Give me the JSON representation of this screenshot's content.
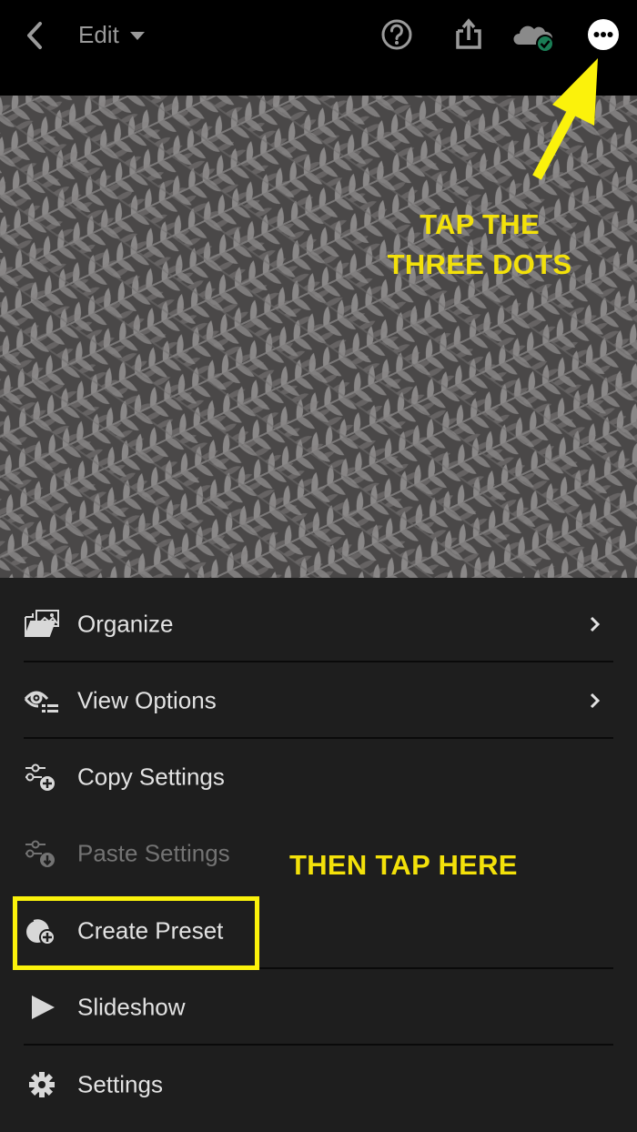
{
  "topbar": {
    "back_icon": "chevron-left-icon",
    "title": "Edit",
    "title_dropdown_icon": "caret-down-icon",
    "actions": [
      {
        "name": "help",
        "icon": "question-circle-icon"
      },
      {
        "name": "share",
        "icon": "share-icon"
      },
      {
        "name": "cloud-sync",
        "icon": "cloud-synced-icon"
      },
      {
        "name": "more",
        "icon": "more-dots-icon"
      }
    ]
  },
  "photo": {
    "subject": "fern leaves (monochrome)"
  },
  "menu": {
    "items": [
      {
        "label": "Organize",
        "icon": "organize-folder-icon",
        "has_submenu": true,
        "enabled": true
      },
      {
        "label": "View Options",
        "icon": "view-options-eye-icon",
        "has_submenu": true,
        "enabled": true
      },
      {
        "label": "Copy Settings",
        "icon": "copy-settings-icon",
        "has_submenu": false,
        "enabled": true
      },
      {
        "label": "Paste Settings",
        "icon": "paste-settings-icon",
        "has_submenu": false,
        "enabled": false
      },
      {
        "label": "Create Preset",
        "icon": "create-preset-icon",
        "has_submenu": false,
        "enabled": true
      },
      {
        "label": "Slideshow",
        "icon": "play-icon",
        "has_submenu": false,
        "enabled": true
      },
      {
        "label": "Settings",
        "icon": "gear-icon",
        "has_submenu": false,
        "enabled": true
      }
    ]
  },
  "annotations": {
    "top_line1": "TAP THE",
    "top_line2": "THREE DOTS",
    "bottom": "THEN TAP HERE",
    "color": "#f3e10a"
  },
  "colors": {
    "topbar_bg": "#000000",
    "menu_bg": "#1e1e1e",
    "sync_badge": "#1a7d55"
  }
}
